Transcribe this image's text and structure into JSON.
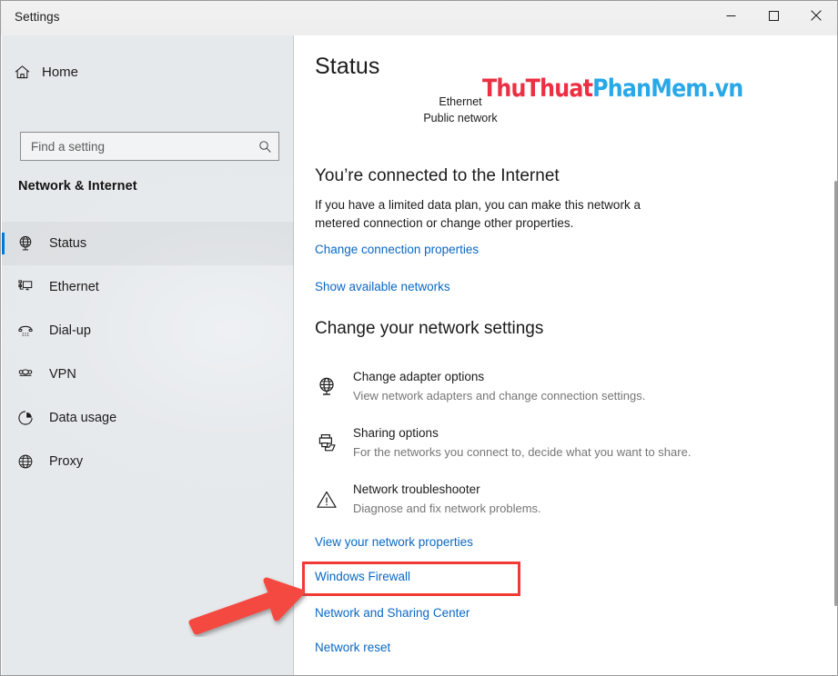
{
  "window": {
    "title": "Settings",
    "controls": {
      "minimize": {
        "name": "minimize-button",
        "glyph": "minimize-icon"
      },
      "maximize": {
        "name": "maximize-button",
        "glyph": "maximize-icon"
      },
      "close": {
        "name": "close-button",
        "glyph": "close-icon"
      }
    }
  },
  "sidebar": {
    "home": {
      "label": "Home",
      "icon": "home-icon"
    },
    "search": {
      "value": "",
      "placeholder": "Find a setting",
      "icon": "search-icon"
    },
    "category": "Network & Internet",
    "accent_color": "#0078d7",
    "items": [
      {
        "label": "Status",
        "icon": "globe-monitor-icon",
        "selected": true
      },
      {
        "label": "Ethernet",
        "icon": "ethernet-icon",
        "selected": false
      },
      {
        "label": "Dial-up",
        "icon": "dialup-phone-icon",
        "selected": false
      },
      {
        "label": "VPN",
        "icon": "vpn-icon",
        "selected": false
      },
      {
        "label": "Data usage",
        "icon": "pie-chart-icon",
        "selected": false
      },
      {
        "label": "Proxy",
        "icon": "globe-icon",
        "selected": false
      }
    ]
  },
  "main": {
    "title": "Status",
    "network": {
      "name": "Ethernet",
      "profile": "Public network"
    },
    "connection": {
      "heading": "You’re connected to the Internet",
      "description": "If you have a limited data plan, you can make this network a metered connection or change other properties."
    },
    "links_top": [
      {
        "label": "Change connection properties"
      },
      {
        "label": "Show available networks"
      }
    ],
    "settings_heading": "Change your network settings",
    "options": [
      {
        "title": "Change adapter options",
        "subtitle": "View network adapters and change connection settings.",
        "icon": "adapter-globe-icon"
      },
      {
        "title": "Sharing options",
        "subtitle": "For the networks you connect to, decide what you want to share.",
        "icon": "sharing-printer-folder-icon"
      },
      {
        "title": "Network troubleshooter",
        "subtitle": "Diagnose and fix network problems.",
        "icon": "warning-triangle-icon"
      }
    ],
    "links_bottom": [
      {
        "label": "View your network properties"
      },
      {
        "label": "Windows Firewall"
      },
      {
        "label": "Network and Sharing Center",
        "highlighted": true
      },
      {
        "label": "Network reset"
      }
    ],
    "link_color": "#0a68c4"
  },
  "annotations": {
    "highlight_color": "#f23a35",
    "arrow_color": "#f4493f",
    "highlight_target": "Network and Sharing Center"
  },
  "watermark": {
    "text_primary": "ThuThuat",
    "text_secondary": "PhanMem.vn",
    "color_primary": "#ec2f43",
    "color_secondary": "#29a8e8"
  }
}
